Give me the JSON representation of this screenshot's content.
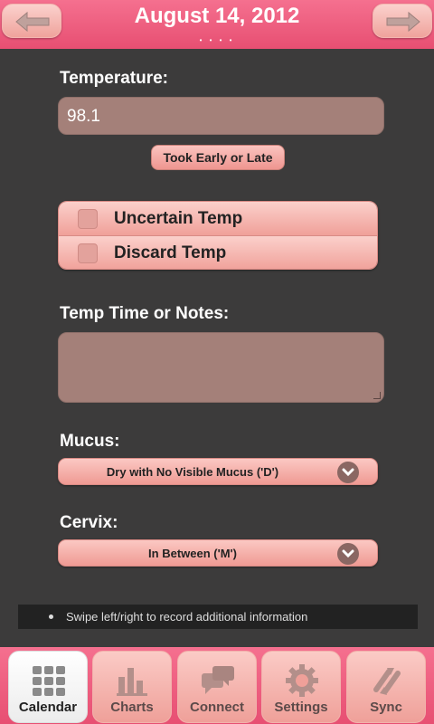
{
  "header": {
    "title": "August 14, 2012",
    "page_dots": "• • • •",
    "prev_icon": "left-arrow",
    "next_icon": "right-arrow"
  },
  "temperature": {
    "label": "Temperature:",
    "value": "98.1",
    "took_early_late_label": "Took Early or Late"
  },
  "temp_options": [
    {
      "label": "Uncertain Temp",
      "checked": false
    },
    {
      "label": "Discard Temp",
      "checked": false
    }
  ],
  "notes": {
    "label": "Temp Time or Notes:",
    "value": ""
  },
  "mucus": {
    "label": "Mucus:",
    "selected": "Dry with No Visible Mucus ('D')"
  },
  "cervix": {
    "label": "Cervix:",
    "selected": "In Between ('M')"
  },
  "hint": "Swipe left/right to record additional information",
  "tabs": [
    {
      "label": "Calendar",
      "icon": "calendar-grid-icon",
      "active": true
    },
    {
      "label": "Charts",
      "icon": "bar-chart-icon",
      "active": false
    },
    {
      "label": "Connect",
      "icon": "chat-bubbles-icon",
      "active": false
    },
    {
      "label": "Settings",
      "icon": "gear-icon",
      "active": false
    },
    {
      "label": "Sync",
      "icon": "sync-arrows-icon",
      "active": false
    }
  ],
  "colors": {
    "header_pink": "#e74f72",
    "background": "#3c3b3b",
    "input_fill": "#a48079",
    "button_pink": "#efa099"
  }
}
